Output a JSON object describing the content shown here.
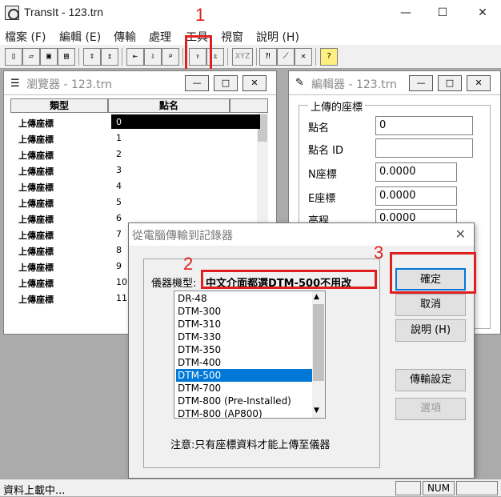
{
  "app": {
    "title": "TransIt - 123.trn"
  },
  "window_controls": {
    "minimize": "—",
    "maximize": "☐",
    "close": "✕"
  },
  "menu": [
    "檔案 (F)",
    "編輯 (E)",
    "傳輸",
    "處理",
    "工具",
    "視窗",
    "說明 (H)"
  ],
  "toolbar": {
    "xyz_label": "XYZ",
    "help_label": "?"
  },
  "annotations": {
    "n1": "1",
    "n2": "2",
    "n3": "3"
  },
  "browser": {
    "title": "瀏覽器 - 123.trn",
    "columns": [
      "類型",
      "點名"
    ],
    "rows": [
      {
        "type": "上傳座標",
        "name": "0"
      },
      {
        "type": "上傳座標",
        "name": "1"
      },
      {
        "type": "上傳座標",
        "name": "2"
      },
      {
        "type": "上傳座標",
        "name": "3"
      },
      {
        "type": "上傳座標",
        "name": "4"
      },
      {
        "type": "上傳座標",
        "name": "5"
      },
      {
        "type": "上傳座標",
        "name": "6"
      },
      {
        "type": "上傳座標",
        "name": "7"
      },
      {
        "type": "上傳座標",
        "name": "8"
      },
      {
        "type": "上傳座標",
        "name": "9"
      },
      {
        "type": "上傳座標",
        "name": "10"
      },
      {
        "type": "上傳座標",
        "name": "11"
      }
    ]
  },
  "editor": {
    "title": "編輯器 - 123.trn",
    "group_label": "上傳的座標",
    "fields": [
      {
        "label": "點名",
        "value": "0"
      },
      {
        "label": "點名 ID",
        "value": ""
      },
      {
        "label": "N座標",
        "value": "0.0000"
      },
      {
        "label": "E座標",
        "value": "0.0000"
      },
      {
        "label": "高程",
        "value": "0.0000"
      }
    ]
  },
  "dialog": {
    "title": "從電腦傳輸到記錄器",
    "instrument_label": "儀器機型:",
    "instrument_note": "中文介面都選DTM-500不用改",
    "models": [
      "DR-48",
      "DTM-300",
      "DTM-310",
      "DTM-330",
      "DTM-350",
      "DTM-400",
      "DTM-500",
      "DTM-700",
      "DTM-800 (Pre-Installed)",
      "DTM-800 (AP800)"
    ],
    "selected_model": "DTM-500",
    "note": "注意:只有座標資料才能上傳至儀器",
    "buttons": {
      "ok": "確定",
      "cancel": "取消",
      "help": "說明 (H)",
      "transfer_settings": "傳輸設定",
      "options": "選項"
    },
    "close": "✕"
  },
  "status": {
    "text": "資料上載中...",
    "num": "NUM"
  }
}
